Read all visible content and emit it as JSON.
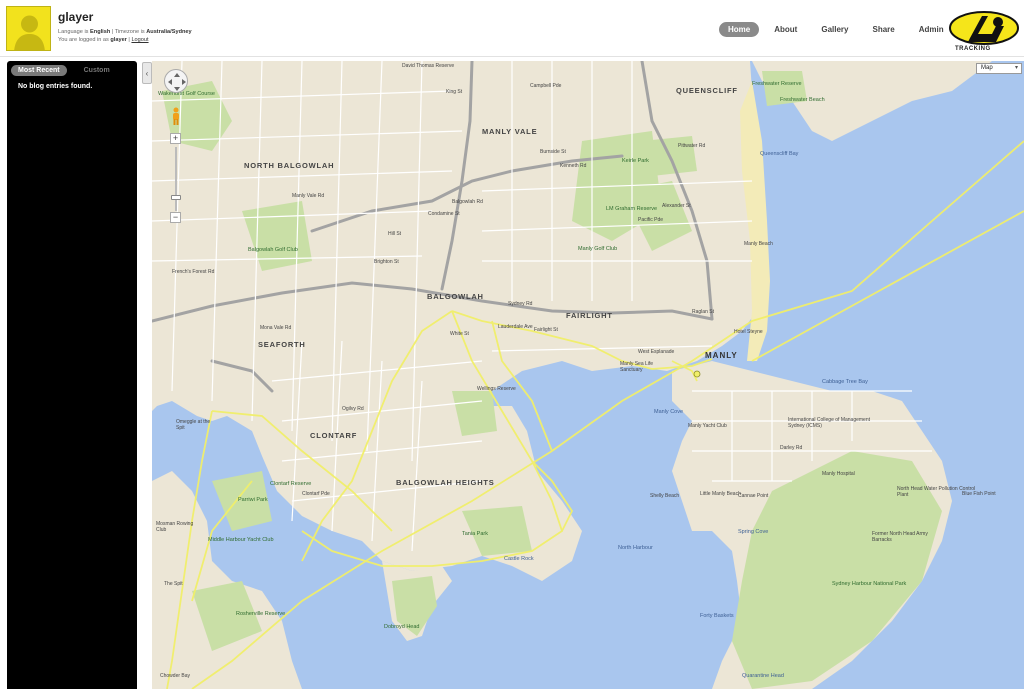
{
  "header": {
    "username": "glayer",
    "language_label": "Language is",
    "language_value": "English",
    "separator": "|",
    "timezone_label": "Timezone is",
    "timezone_value": "Australia/Sydney",
    "logged_in_prefix": "You are logged in as",
    "logged_in_user": "glayer",
    "logout_label": "Logout",
    "nav": [
      {
        "label": "Home",
        "active": true
      },
      {
        "label": "About",
        "active": false
      },
      {
        "label": "Gallery",
        "active": false
      },
      {
        "label": "Share",
        "active": false
      },
      {
        "label": "Admin",
        "active": false
      }
    ],
    "logo_text": "TRACKING"
  },
  "sidebar": {
    "tabs": [
      {
        "label": "Most Recent",
        "active": true
      },
      {
        "label": "Custom",
        "active": false
      }
    ],
    "empty_message": "No blog entries found.",
    "collapse_icon": "chevron-left-icon"
  },
  "map": {
    "map_type": "Map",
    "zoom_in": "+",
    "zoom_out": "−",
    "colors": {
      "water": "#a9c6ee",
      "land": "#ece6d6",
      "park": "#c9dfa6",
      "road": "#ffffff",
      "highway": "#9a9a9a",
      "track": "#f1ef6a"
    },
    "labels": {
      "suburbs": [
        "MANLY VALE",
        "NORTH BALGOWLAH",
        "BALGOWLAH",
        "SEAFORTH",
        "FAIRLIGHT",
        "MANLY",
        "CLONTARF",
        "BALGOWLAH HEIGHTS",
        "QUEENSCLIFF"
      ],
      "roads": [
        "David Thomas Reserve",
        "King St",
        "Kenneth Rd",
        "Campbell Pde",
        "Burnside St",
        "Pittwater Rd",
        "Condamine St",
        "Sydney Rd",
        "Balgowlah Rd",
        "Hill St",
        "Brighton St",
        "French's Forest Rd",
        "Manly Vale Rd",
        "White St",
        "Fairlight St",
        "Wellings Reserve",
        "Ogilvy Rd",
        "Clontarf Pde",
        "Lauderdale Ave",
        "Darley Rd",
        "West Esplanade",
        "Raglan St",
        "Mona Vale Rd",
        "Pacific Pde",
        "Alexander St"
      ],
      "parks": [
        "Wakehurst Golf Course",
        "Balgowlah Golf Club",
        "Manly Golf Club",
        "LM Graham Reserve",
        "Keirle Park",
        "Freshwater Reserve",
        "Freshwater Beach",
        "Queenscliff Bay",
        "Manly Beach",
        "Cabbage Tree Bay",
        "Clontarf Reserve",
        "Parriwi Park",
        "Middle Harbour Yacht Club",
        "Tania Park",
        "Dobroyd Head",
        "Rosherville Reserve",
        "Sydney Harbour National Park",
        "Blue Fish Point",
        "Manly Hospital",
        "North Head Water Pollution Control Plant",
        "Former North Head Army Barracks"
      ],
      "water": [
        "Manly Cove",
        "North Harbour",
        "Spring Cove",
        "Quarantine Head",
        "Forty Baskets",
        "Castle Rock"
      ],
      "poi": [
        "Hotel Steyne",
        "Manly Sea Life Sanctuary",
        "Manly Yacht Club",
        "International College of Management Sydney (ICMS)",
        "The Spit",
        "Little Manly Beach",
        "Shelly Beach",
        "Cannae Point",
        "Omeggle at the Spit",
        "Mosman Rowing Club",
        "Chowder Bay"
      ]
    }
  }
}
